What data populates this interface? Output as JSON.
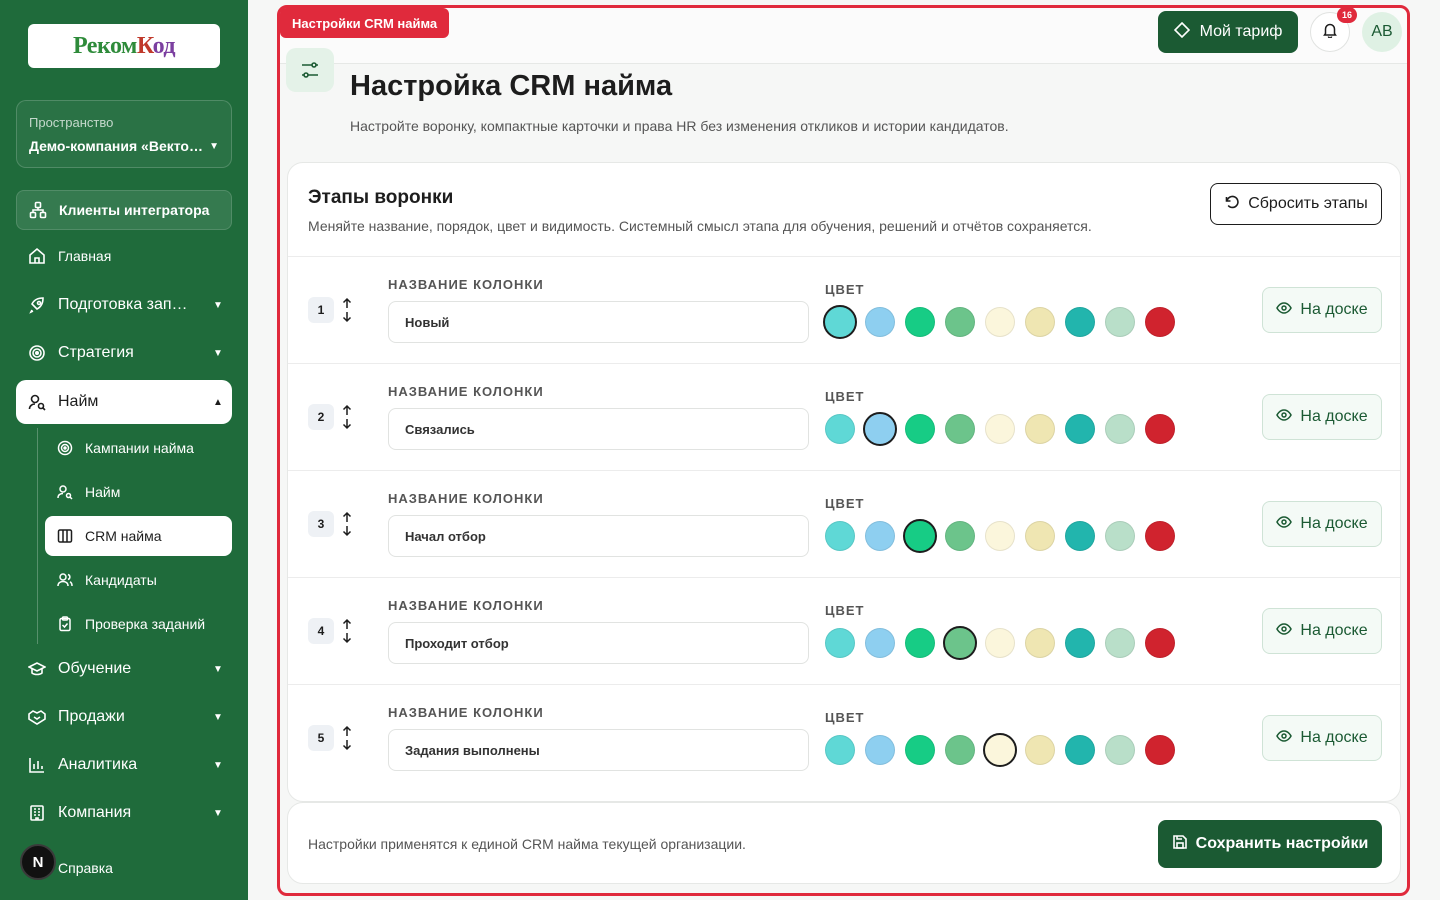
{
  "sidebar": {
    "logo": "РекомКод",
    "space_label": "Пространство",
    "space_value": "Демо-компания «Векто…",
    "integrator": "Клиенты интегратора",
    "nav": [
      {
        "label": "Главная"
      },
      {
        "label": "Подготовка зап…"
      },
      {
        "label": "Стратегия"
      },
      {
        "label": "Найм"
      },
      {
        "label": "Обучение"
      },
      {
        "label": "Продажи"
      },
      {
        "label": "Аналитика"
      },
      {
        "label": "Компания"
      },
      {
        "label": "Справка"
      }
    ],
    "sub": [
      {
        "label": "Кампании найма"
      },
      {
        "label": "Найм"
      },
      {
        "label": "CRM найма"
      },
      {
        "label": "Кандидаты"
      },
      {
        "label": "Проверка заданий"
      }
    ],
    "user_initial": "N"
  },
  "overlay_badge": "Настройки CRM найма",
  "header": {
    "tariff": "Мой тариф",
    "notifications": "16",
    "avatar": "AB"
  },
  "page": {
    "title": "Настройка CRM найма",
    "subtitle": "Настройте воронку, компактные карточки и права HR без изменения откликов и истории кандидатов."
  },
  "funnel": {
    "title": "Этапы воронки",
    "subtitle": "Меняйте название, порядок, цвет и видимость. Системный смысл этапа для обучения, решений и отчётов сохраняется.",
    "reset": "Сбросить этапы",
    "field_label": "НАЗВАНИЕ КОЛОНКИ",
    "color_label": "ЦВЕТ",
    "board_label": "На доске",
    "palette": [
      "#5fd8d6",
      "#8ecff0",
      "#17cc85",
      "#6cc48b",
      "#fbf6dc",
      "#efe6b2",
      "#22b5ad",
      "#b9dfc9",
      "#d0232e"
    ],
    "stages": [
      {
        "num": "1",
        "name": "Новый",
        "selected": 0
      },
      {
        "num": "2",
        "name": "Связались",
        "selected": 1
      },
      {
        "num": "3",
        "name": "Начал отбор",
        "selected": 2
      },
      {
        "num": "4",
        "name": "Проходит отбор",
        "selected": 3
      },
      {
        "num": "5",
        "name": "Задания выполнены",
        "selected": 4
      }
    ]
  },
  "footer": {
    "note": "Настройки применятся к единой CRM найма текущей организации.",
    "save": "Сохранить настройки"
  }
}
